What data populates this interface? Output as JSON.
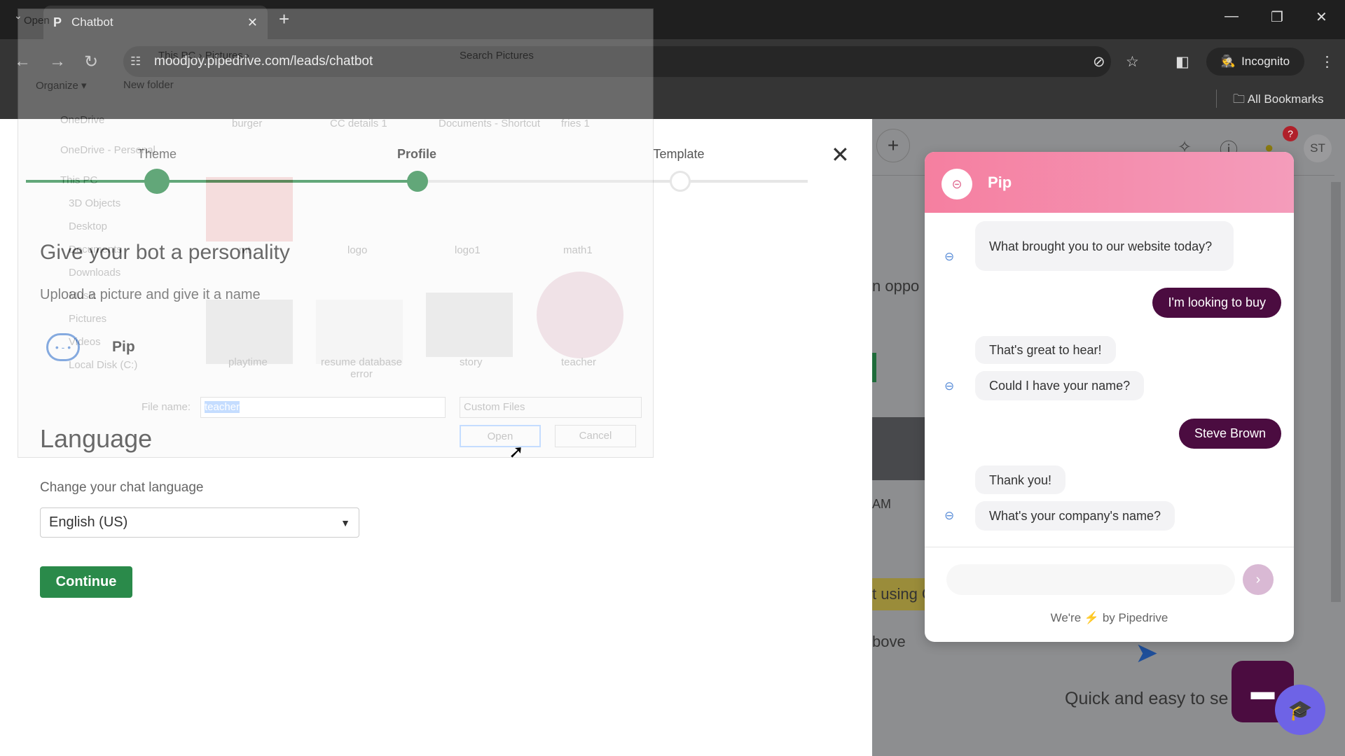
{
  "browser": {
    "tab_title": "Chatbot",
    "url": "moodjoy.pipedrive.com/leads/chatbot",
    "incognito_label": "Incognito",
    "bookmarks_label": "All Bookmarks"
  },
  "wizard": {
    "steps": [
      {
        "label": "Theme",
        "state": "done"
      },
      {
        "label": "Profile",
        "state": "current"
      },
      {
        "label": "Template",
        "state": "todo"
      }
    ],
    "progress_percent": 50,
    "title": "Give your bot a personality",
    "subtitle": "Upload a picture and give it a name",
    "bot_name": "Pip",
    "language_title": "Language",
    "language_label": "Change your chat language",
    "language_value": "English (US)",
    "continue_label": "Continue",
    "accent": "#2a8a4a"
  },
  "file_dialog": {
    "title": "Open",
    "breadcrumb": [
      "This PC",
      "Pictures"
    ],
    "search_placeholder": "Search Pictures",
    "organize": "Organize ▾",
    "new_folder": "New folder",
    "sidebar": [
      "OneDrive",
      "OneDrive - Personal",
      "This PC",
      "3D Objects",
      "Desktop",
      "Documents",
      "Downloads",
      "Music",
      "Pictures",
      "Videos",
      "Local Disk (C:)"
    ],
    "files": [
      "burger",
      "CC details 1",
      "Documents - Shortcut",
      "fries 1",
      "mt",
      "logo",
      "logo1",
      "math1",
      "playtime",
      "resume database error",
      "story",
      "teacher"
    ],
    "file_name_label": "File name:",
    "file_name": "teacher",
    "filter": "Custom Files",
    "open": "Open",
    "cancel": "Cancel"
  },
  "background_page": {
    "fragments": [
      "n oppo",
      "AM",
      "t using C",
      "bove",
      "Quick and easy to se"
    ],
    "avatar": "ST"
  },
  "chat": {
    "title": "Pip",
    "header_color": "#f57fa0",
    "user_bubble_color": "#4b0c40",
    "messages": [
      {
        "from": "bot",
        "text": "What brought you to our website today?"
      },
      {
        "from": "user",
        "text": "I'm looking to buy"
      },
      {
        "from": "bot",
        "text": "That's great to hear!"
      },
      {
        "from": "bot",
        "text": "Could I have your name?"
      },
      {
        "from": "user",
        "text": "Steve Brown"
      },
      {
        "from": "bot",
        "text": "Thank you!"
      },
      {
        "from": "bot",
        "text": "What's your company's name?"
      }
    ],
    "footer_prefix": "We're",
    "footer_suffix": "by Pipedrive"
  }
}
